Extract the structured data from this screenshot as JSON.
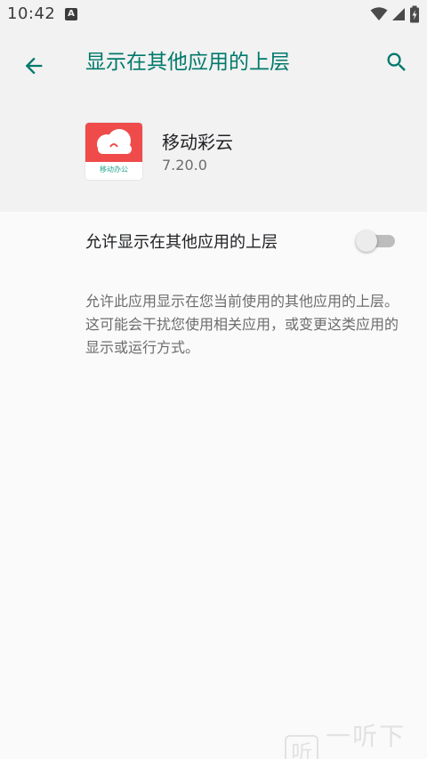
{
  "status_bar": {
    "time": "10:42",
    "notification_badge": "A",
    "icons": [
      "wifi-icon",
      "signal-icon",
      "battery-icon"
    ]
  },
  "toolbar": {
    "title": "显示在其他应用的上层",
    "back_icon": "arrow-back-icon",
    "search_icon": "search-icon",
    "accent_color": "#00796b"
  },
  "app_info": {
    "name": "移动彩云",
    "version": "7.20.0",
    "icon_caption": "移动办公",
    "icon_color": "#ef4b4b"
  },
  "setting": {
    "label": "允许显示在其他应用的上层",
    "enabled": false,
    "description": "允许此应用显示在您当前使用的其他应用的上层。这可能会干扰您使用相关应用，或变更这类应用的显示或运行方式。"
  },
  "watermark": {
    "text": "一听下载",
    "glyph": "听"
  }
}
